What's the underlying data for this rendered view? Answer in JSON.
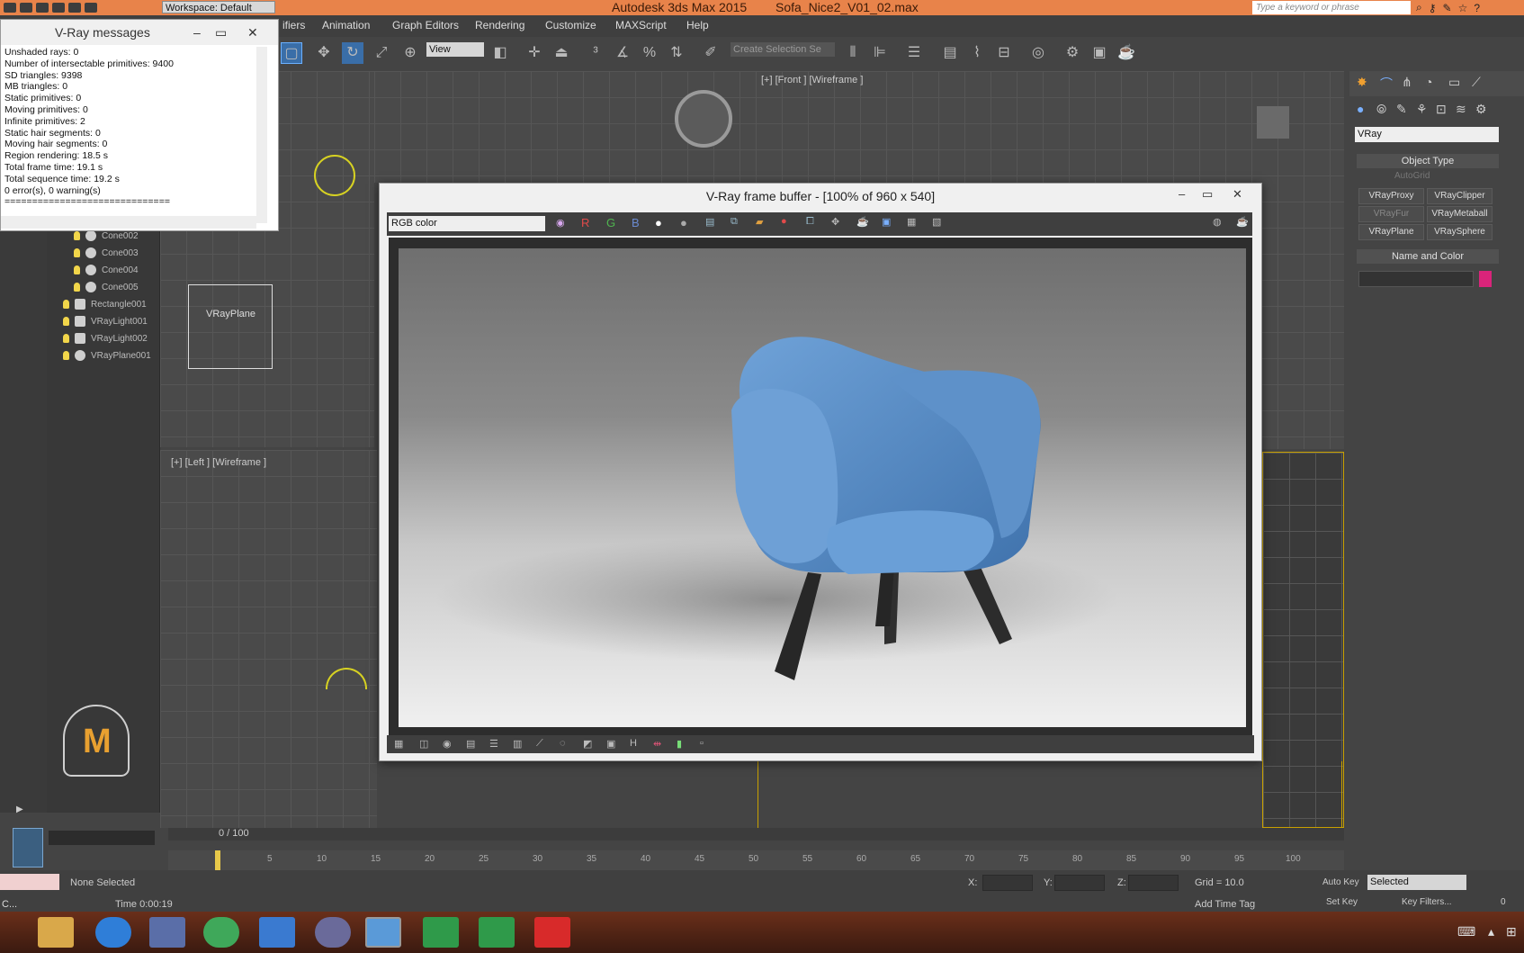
{
  "titlebar": {
    "workspace": "Workspace: Default",
    "app": "Autodesk 3ds Max  2015",
    "file": "Sofa_Nice2_V01_02.max",
    "search_placeholder": "Type a keyword or phrase"
  },
  "menu": [
    "ifiers",
    "Animation",
    "Graph Editors",
    "Rendering",
    "Customize",
    "MAXScript",
    "Help"
  ],
  "toolbar": {
    "view_select": "View",
    "selection_set": "Create Selection Se"
  },
  "viewports": {
    "front_label": "[+] [Front ] [Wireframe ]",
    "left_label": "[+] [Left ] [Wireframe ]",
    "plane_label": "VRayPlane"
  },
  "scene_objects": [
    {
      "name": "Cone002"
    },
    {
      "name": "Cone003"
    },
    {
      "name": "Cone004"
    },
    {
      "name": "Cone005"
    },
    {
      "name": "Rectangle001"
    },
    {
      "name": "VRayLight001"
    },
    {
      "name": "VRayLight002"
    },
    {
      "name": "VRayPlane001"
    }
  ],
  "vray_messages": {
    "title": "V-Ray messages",
    "lines": [
      "Unshaded rays: 0",
      "Number of intersectable primitives: 9400",
      "SD triangles: 9398",
      "MB triangles: 0",
      "Static primitives: 0",
      "Moving primitives: 0",
      "Infinite primitives: 2",
      "Static hair segments: 0",
      "Moving hair segments: 0",
      "Region rendering: 18.5 s",
      "Total frame time: 19.1 s",
      "Total sequence time: 19.2 s",
      "0 error(s), 0 warning(s)",
      "=============================="
    ]
  },
  "frame_buffer": {
    "title": "V-Ray frame buffer - [100% of 960 x 540]",
    "channel": "RGB color",
    "r": "R",
    "g": "G",
    "b": "B"
  },
  "command_panel": {
    "renderer": "VRay",
    "object_type_header": "Object Type",
    "autogrid": "AutoGrid",
    "buttons": [
      "VRayProxy",
      "VRayClipper",
      "VRayFur",
      "VRayMetaball",
      "VRayPlane",
      "VRaySphere"
    ],
    "name_color_header": "Name and Color",
    "swatch_color": "#d9247a"
  },
  "timeline": {
    "frame_counter": "0 / 100",
    "ticks": [
      "5",
      "10",
      "15",
      "20",
      "25",
      "30",
      "35",
      "40",
      "45",
      "50",
      "55",
      "60",
      "65",
      "70",
      "75",
      "80",
      "85",
      "90",
      "95",
      "100"
    ]
  },
  "status": {
    "selection": "None Selected",
    "time": "Time  0:00:19",
    "x_label": "X:",
    "y_label": "Y:",
    "z_label": "Z:",
    "grid": "Grid = 10.0",
    "auto_key": "Auto Key",
    "set_key": "Set Key",
    "key_mode": "Selected",
    "key_filters": "Key Filters...",
    "add_time_tag": "Add Time Tag",
    "frame": "0",
    "mini_left": "C..."
  },
  "colors": {
    "titlebar": "#e8834a",
    "chair": "#5b8ec4",
    "selection_highlight": "#c8a000"
  }
}
